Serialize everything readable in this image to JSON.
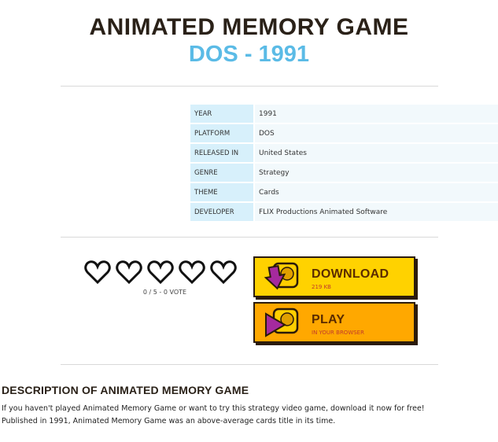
{
  "header": {
    "title": "ANIMATED MEMORY GAME",
    "subtitle": "DOS - 1991"
  },
  "info": [
    {
      "key": "YEAR",
      "value": "1991"
    },
    {
      "key": "PLATFORM",
      "value": "DOS"
    },
    {
      "key": "RELEASED IN",
      "value": "United States"
    },
    {
      "key": "GENRE",
      "value": "Strategy"
    },
    {
      "key": "THEME",
      "value": "Cards"
    },
    {
      "key": "DEVELOPER",
      "value": "FLIX Productions Animated Software"
    }
  ],
  "rating": {
    "hearts_total": 5,
    "hearts_filled": 0,
    "votes_text": "0 / 5 - 0 VOTE"
  },
  "download": {
    "label": "DOWNLOAD",
    "size": "219 KB"
  },
  "play": {
    "label": "PLAY",
    "sub": "IN YOUR BROWSER"
  },
  "description": {
    "heading": "DESCRIPTION OF ANIMATED MEMORY GAME",
    "line1": "If you haven't played Animated Memory Game or want to try this strategy video game, download it now for free!",
    "line2": "Published in 1991, Animated Memory Game was an above-average cards title in its time."
  },
  "colors": {
    "title": "#2a2118",
    "subtitle": "#5bbbe6",
    "download_bg": "#ffd200",
    "play_bg": "#ffa800",
    "info_key_bg": "#d7f0fb"
  }
}
